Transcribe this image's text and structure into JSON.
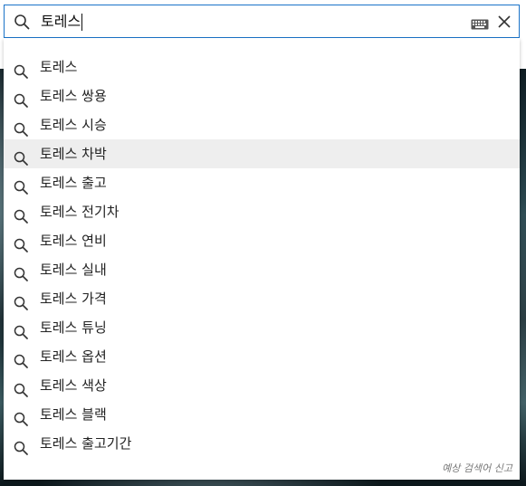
{
  "search": {
    "query": "토레스",
    "icons": {
      "search": "search-icon",
      "keyboard": "keyboard-icon",
      "clear": "close-icon"
    }
  },
  "suggestions": [
    {
      "label": "토레스",
      "highlighted": false
    },
    {
      "label": "토레스 쌍용",
      "highlighted": false
    },
    {
      "label": "토레스 시승",
      "highlighted": false
    },
    {
      "label": "토레스 차박",
      "highlighted": true
    },
    {
      "label": "토레스 출고",
      "highlighted": false
    },
    {
      "label": "토레스 전기차",
      "highlighted": false
    },
    {
      "label": "토레스 연비",
      "highlighted": false
    },
    {
      "label": "토레스 실내",
      "highlighted": false
    },
    {
      "label": "토레스 가격",
      "highlighted": false
    },
    {
      "label": "토레스 튜닝",
      "highlighted": false
    },
    {
      "label": "토레스 옵션",
      "highlighted": false
    },
    {
      "label": "토레스 색상",
      "highlighted": false
    },
    {
      "label": "토레스 블랙",
      "highlighted": false
    },
    {
      "label": "토레스 출고기간",
      "highlighted": false
    }
  ],
  "footer": {
    "report_label": "예상 검색어 신고"
  },
  "colors": {
    "focus_border": "#1a73c8",
    "highlight_bg": "#eeeeee"
  }
}
